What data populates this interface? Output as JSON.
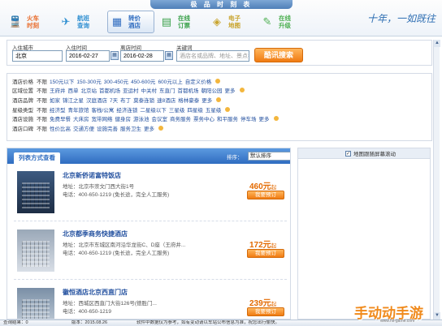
{
  "app": {
    "title": "极 品 时 刻 表",
    "signature": "十年，一如既往"
  },
  "toolbar": [
    {
      "label": "火车\n时刻",
      "icon": "train-icon",
      "color": "#e96b2a"
    },
    {
      "label": "航班\n查询",
      "icon": "plane-icon",
      "color": "#2f8fd1"
    },
    {
      "label": "转价\n酒店",
      "icon": "hotel-icon",
      "color": "#2f6cc0",
      "active": true
    },
    {
      "label": "在线\n订票",
      "icon": "ticket-icon",
      "color": "#3aa14a"
    },
    {
      "label": "电子\n地图",
      "icon": "map-icon",
      "color": "#c9a530"
    },
    {
      "label": "在线\n升级",
      "icon": "upgrade-icon",
      "color": "#4caf50"
    }
  ],
  "search": {
    "city_label": "入住城市",
    "city_value": "北京",
    "checkin_label": "入住时间",
    "checkin_value": "2016-02-27",
    "checkout_label": "离店时间",
    "checkout_value": "2016-02-28",
    "keyword_label": "关键词",
    "keyword_placeholder": "酒店名或品牌、地址、景点名",
    "button": "酷讯搜索"
  },
  "filters": [
    {
      "name": "酒店价格",
      "options": [
        "不限",
        "150元以下",
        "150-300元",
        "300-450元",
        "450-600元",
        "600元以上",
        "自定义价格"
      ]
    },
    {
      "name": "区域位置",
      "options": [
        "不限",
        "王府井",
        "西单",
        "北京站",
        "首都机场",
        "亚运村",
        "中关村",
        "东直门",
        "首都机场",
        "朝阳公园",
        "更多"
      ]
    },
    {
      "name": "酒店品牌",
      "options": [
        "不限",
        "如家",
        "锦江之星",
        "汉庭酒店",
        "7天",
        "布丁",
        "莫泰连锁",
        "速8酒店",
        "格林豪泰",
        "更多"
      ]
    },
    {
      "name": "星级类型",
      "options": [
        "不限",
        "经济型",
        "青年旅馆",
        "客栈/公寓",
        "经济连锁",
        "二星级以下",
        "三星级",
        "四星级",
        "五星级"
      ]
    },
    {
      "name": "酒店设施",
      "options": [
        "不限",
        "免费早餐",
        "大床房",
        "宽带网络",
        "健身房",
        "游泳池",
        "会议室",
        "商务服务",
        "票务中心",
        "和平服务",
        "停车场",
        "更多"
      ]
    },
    {
      "name": "酒店口碑",
      "options": [
        "不限",
        "性价比高",
        "交通方便",
        "设施完善",
        "服务卫生",
        "更多"
      ]
    }
  ],
  "results": {
    "tab": "列表方式查看",
    "sort_label": "排序：",
    "sort_value": "默认排序",
    "hotels": [
      {
        "name": "北京新侨诺富特饭店",
        "address": "地址：北京市崇文门西大街1号",
        "phone": "电话：400-650-1219 (免长途，完全人工服务)",
        "price": "460元",
        "price_suffix": "起",
        "book": "我要预订"
      },
      {
        "name": "北京都季商务快捷酒店",
        "address": "地址：北京市东城区南河沿华龙街C、D座（王府井...",
        "phone": "电话：400-650-1219 (免长途，完全人工服务)",
        "price": "172元",
        "price_suffix": "起",
        "book": "我要预订"
      },
      {
        "name": "徽恒酒店北京西直门店",
        "address": "地址：西城区西直门大街126号(德胜门...",
        "phone": "电话：400-650-1219",
        "price": "239元",
        "price_suffix": "起",
        "book": "我要预订"
      }
    ]
  },
  "map": {
    "checkbox_label": "地图跟随屏幕滚动",
    "checked": true
  },
  "statusbar": {
    "hits": "查询结果：0",
    "version": "版本：2015.08.26",
    "message": "软件中数据仅为参考，如有变动请以车站公布信息为准，祝您出行愉快。"
  },
  "watermark": {
    "text": "手动动手游",
    "sub": "www.hit-game.com"
  }
}
